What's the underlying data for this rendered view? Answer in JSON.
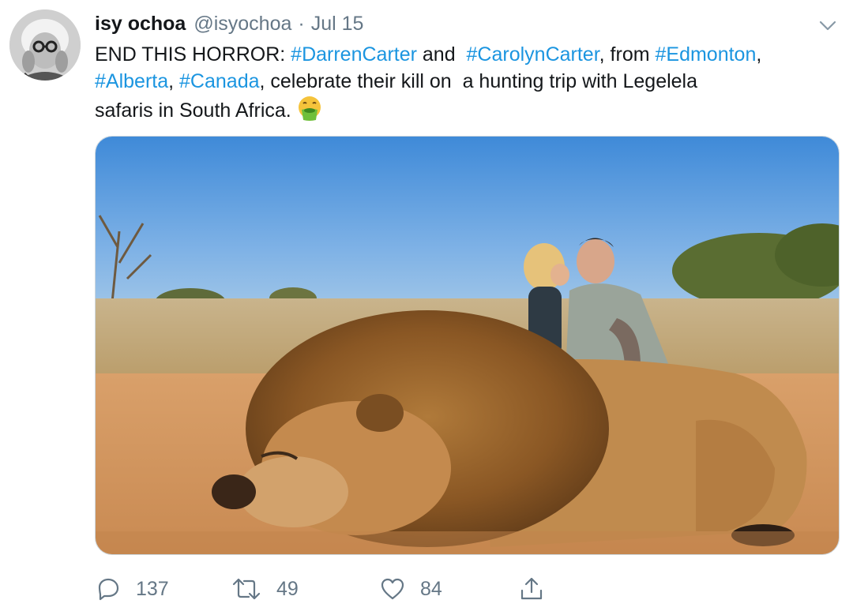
{
  "tweet": {
    "display_name": "isy ochoa",
    "handle": "@isyochoa",
    "separator": "·",
    "date": "Jul 15",
    "text_line1": {
      "t1": "END THIS HORROR: ",
      "h1": "#DarrenCarter",
      "t2": " and  ",
      "h2": "#CarolynCarter",
      "t3": ", from ",
      "h3": "#Edmonton",
      "t4": ","
    },
    "text_line2": {
      "h1": "#Alberta",
      "t1": ", ",
      "h2": "#Canada",
      "t2": ", celebrate their kill on  a hunting trip with Legelela"
    },
    "text_line3": {
      "t1": "safaris in South Africa."
    },
    "emoji": "face-vomiting-emoji"
  },
  "actions": {
    "reply_count": "137",
    "retweet_count": "49",
    "like_count": "84"
  },
  "icons": {
    "reply": "reply-icon",
    "retweet": "retweet-icon",
    "like": "like-icon",
    "share": "share-icon",
    "menu": "chevron-down-icon"
  },
  "colors": {
    "hashtag": "#1b95e0",
    "secondary_text": "#657786",
    "primary_text": "#14171a",
    "border": "#ccd6dd"
  }
}
